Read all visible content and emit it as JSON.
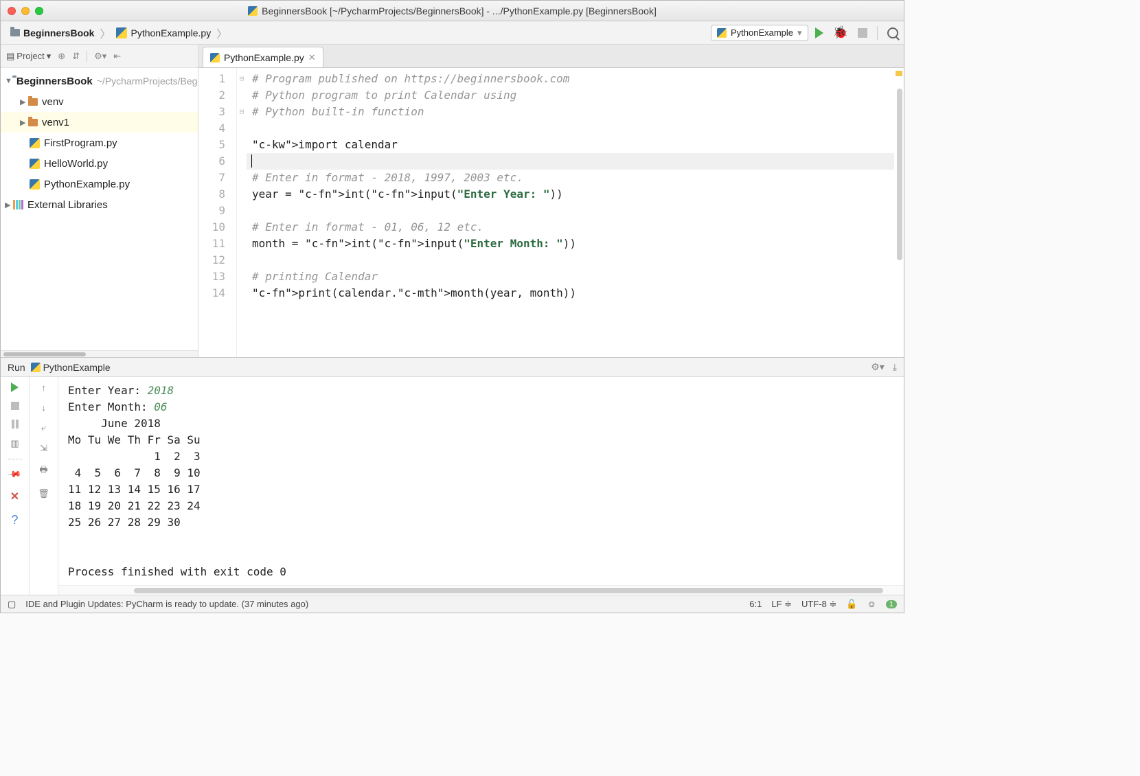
{
  "title": "BeginnersBook [~/PycharmProjects/BeginnersBook] - .../PythonExample.py [BeginnersBook]",
  "breadcrumb": {
    "project": "BeginnersBook",
    "file": "PythonExample.py"
  },
  "run_config": "PythonExample",
  "project_panel": {
    "label": "Project",
    "root": "BeginnersBook",
    "root_path": "~/PycharmProjects/BeginnersBook",
    "items": [
      {
        "name": "venv",
        "type": "folder"
      },
      {
        "name": "venv1",
        "type": "folder"
      },
      {
        "name": "FirstProgram.py",
        "type": "py"
      },
      {
        "name": "HelloWorld.py",
        "type": "py"
      },
      {
        "name": "PythonExample.py",
        "type": "py"
      }
    ],
    "external": "External Libraries"
  },
  "editor": {
    "tab": "PythonExample.py",
    "lines": [
      "# Program published on https://beginnersbook.com",
      "# Python program to print Calendar using",
      "# Python built-in function",
      "",
      "import calendar",
      "",
      "# Enter in format - 2018, 1997, 2003 etc.",
      "year = int(input(\"Enter Year: \"))",
      "",
      "# Enter in format - 01, 06, 12 etc.",
      "month = int(input(\"Enter Month: \"))",
      "",
      "# printing Calendar",
      "print(calendar.month(year, month))"
    ]
  },
  "run_panel": {
    "label": "Run",
    "config": "PythonExample",
    "output": {
      "prompt_year": "Enter Year: ",
      "input_year": "2018",
      "prompt_month": "Enter Month: ",
      "input_month": "06",
      "calendar": "     June 2018\nMo Tu We Th Fr Sa Su\n             1  2  3\n 4  5  6  7  8  9 10\n11 12 13 14 15 16 17\n18 19 20 21 22 23 24\n25 26 27 28 29 30",
      "exit": "Process finished with exit code 0"
    }
  },
  "status": {
    "message": "IDE and Plugin Updates: PyCharm is ready to update. (37 minutes ago)",
    "caret": "6:1",
    "line_sep": "LF",
    "encoding": "UTF-8",
    "badge": "1"
  }
}
